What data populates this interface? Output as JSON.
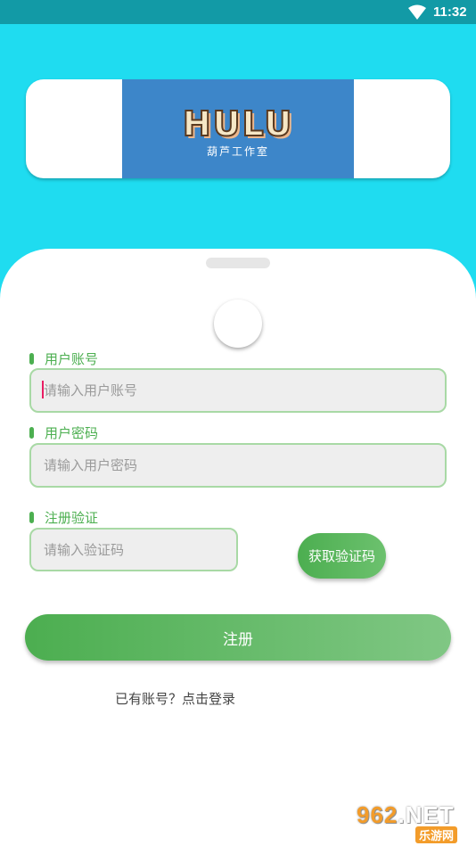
{
  "status_bar": {
    "time": "11:32",
    "icons": [
      "wifi-icon"
    ]
  },
  "logo": {
    "word": "HULU",
    "subtitle": "葫芦工作室"
  },
  "form": {
    "account": {
      "label": "用户账号",
      "placeholder": "请输入用户账号",
      "value": ""
    },
    "password": {
      "label": "用户密码",
      "placeholder": "请输入用户密码",
      "value": ""
    },
    "verify": {
      "label": "注册验证",
      "placeholder": "请输入验证码",
      "value": "",
      "button_label": "获取验证码"
    },
    "register_label": "注册",
    "login_link": "已有账号？点击登录"
  },
  "watermark": {
    "top_prefix": "962",
    "top_suffix": ".NET",
    "bottom": "乐游网"
  },
  "colors": {
    "background": "#1fdcf0",
    "status_bar": "#129aa6",
    "accent_green": "#4caf50",
    "logo_panel": "#3d86c9"
  }
}
